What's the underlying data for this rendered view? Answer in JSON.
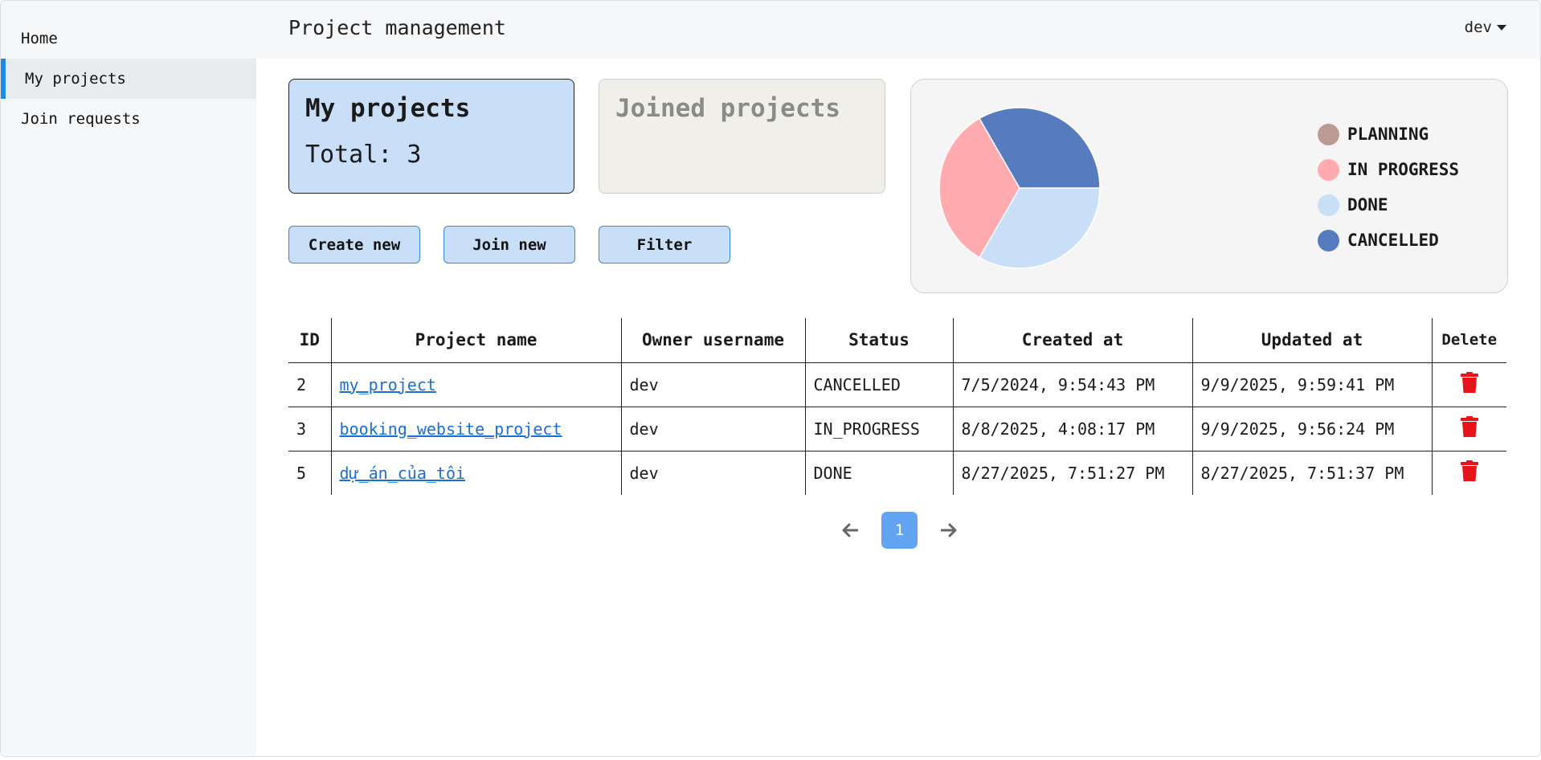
{
  "sidebar": {
    "items": [
      {
        "label": "Home",
        "active": false
      },
      {
        "label": "My projects",
        "active": true
      },
      {
        "label": "Join requests",
        "active": false
      }
    ]
  },
  "header": {
    "title": "Project management",
    "user": "dev"
  },
  "cards": {
    "mine": {
      "title": "My projects",
      "total": "Total: 3"
    },
    "joined": {
      "title": "Joined projects"
    }
  },
  "actions": {
    "create_label": "Create new",
    "join_label": "Join new",
    "filter_label": "Filter"
  },
  "chart_data": {
    "type": "pie",
    "title": "",
    "slices": [
      {
        "label": "PLANNING",
        "value": 0,
        "color": "#bc9a94"
      },
      {
        "label": "IN PROGRESS",
        "value": 1,
        "color": "#ffabb0"
      },
      {
        "label": "DONE",
        "value": 1,
        "color": "#c9dff7"
      },
      {
        "label": "CANCELLED",
        "value": 1,
        "color": "#567bbf"
      }
    ],
    "legend": "right"
  },
  "table": {
    "headers": [
      "ID",
      "Project name",
      "Owner username",
      "Status",
      "Created at",
      "Updated at",
      "Delete"
    ],
    "rows": [
      {
        "id": "2",
        "name": "my_project",
        "owner": "dev",
        "status": "CANCELLED",
        "created": "7/5/2024, 9:54:43 PM",
        "updated": "9/9/2025, 9:59:41 PM"
      },
      {
        "id": "3",
        "name": "booking_website_project",
        "owner": "dev",
        "status": "IN_PROGRESS",
        "created": "8/8/2025, 4:08:17 PM",
        "updated": "9/9/2025, 9:56:24 PM"
      },
      {
        "id": "5",
        "name": "dự_án_của_tôi",
        "owner": "dev",
        "status": "DONE",
        "created": "8/27/2025, 7:51:27 PM",
        "updated": "8/27/2025, 7:51:37 PM"
      }
    ],
    "delete_icon": "trash-icon",
    "delete_color": "#e8141c"
  },
  "pagination": {
    "current_page": "1",
    "prev_icon": "arrow-left-icon",
    "next_icon": "arrow-right-icon"
  }
}
